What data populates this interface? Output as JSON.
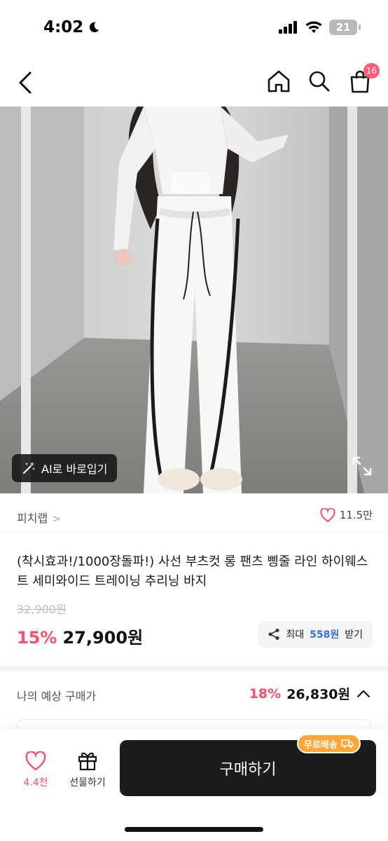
{
  "status_bar": {
    "time": "4:02",
    "battery": "21"
  },
  "nav": {
    "cart_count": "16"
  },
  "image": {
    "ai_button_label": "AI로 바로입기"
  },
  "brand": {
    "name": "피치랩",
    "chevron": ">",
    "likes": "11.5만"
  },
  "product": {
    "title": "(착시효과!/1000장돌파!) 사선 부츠컷 롱 팬츠 삥줄 라인 하이웨스트 세미와이드 트레이닝 추리닝 바지",
    "original_price": "32,900원",
    "discount": "15%",
    "price": "27,900원"
  },
  "share": {
    "prefix": "최대",
    "points": "558원",
    "suffix": "받기"
  },
  "expected": {
    "label": "나의 예상 구매가",
    "discount": "18%",
    "price": "26,830원"
  },
  "bottom_bar": {
    "wish_count": "4.4천",
    "gift_label": "선물하기",
    "buy_label": "구매하기",
    "shipping_badge": "무료배송"
  },
  "colors": {
    "accent": "#ff4d6d",
    "point": "#3a6fd8",
    "buy_button": "#1c1c1e",
    "shipping_badge": "#ffa534"
  }
}
